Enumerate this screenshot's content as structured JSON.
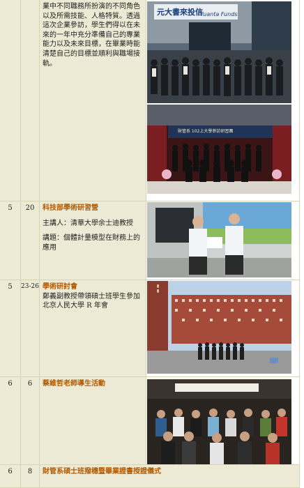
{
  "rows": [
    {
      "month": "",
      "day": "",
      "text": "業中不同職務所扮演的不同角色以及所需技能、人格特質。透過這次企業參訪，學生們得以在未來的一年中充分準備自己的專業能力以及未來目標，在畢業時能清楚自己的目標並順利與職場接軌。",
      "photo1_signs": [
        "元大書來投信",
        "Yuanta Funds"
      ],
      "photo2_banner": "財管系 102上大學參訪研習團"
    },
    {
      "month": "5",
      "day": "20",
      "title": "科技部學術研習營",
      "speaker": "主講人：清華大學余士迪教授",
      "topic": "講題：個體計量模型在財務上的應用"
    },
    {
      "month": "5",
      "day": "23-26",
      "title": "學術研討會",
      "text": "鄭義副教授帶領碩士班學生參加北京人民大學 R 年會"
    },
    {
      "month": "6",
      "day": "6",
      "title": "蔡維哲老師導生活動"
    },
    {
      "month": "6",
      "day": "8",
      "title": "財管系碩士班撥穗暨畢業證書授證儀式"
    }
  ],
  "colors": {
    "cell_bg": "#edebd5",
    "title": "#b35a00",
    "border": "#d7d4b6"
  }
}
